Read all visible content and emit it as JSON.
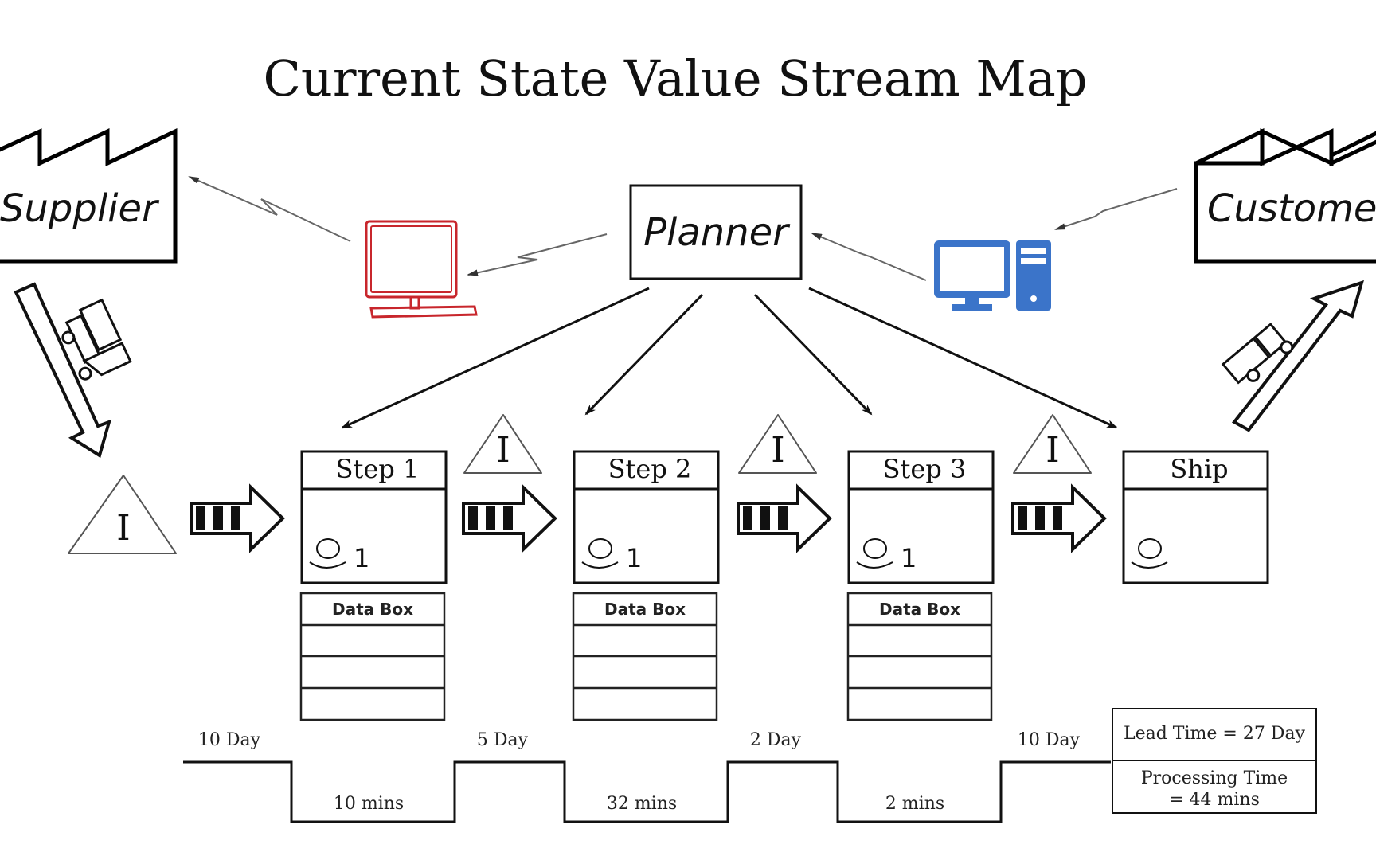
{
  "title": "Current State Value Stream Map",
  "supplier": {
    "label": "Supplier",
    "icon": "factory-icon"
  },
  "customer": {
    "label": "Customer",
    "icon": "factory-icon"
  },
  "planner": {
    "label": "Planner"
  },
  "info_systems": [
    {
      "name": "supplier-computer",
      "icon": "computer-monitor-icon",
      "color": "#c8262c"
    },
    {
      "name": "customer-computer",
      "icon": "desktop-computer-icon",
      "color": "#3b74c9"
    }
  ],
  "shipments": [
    {
      "direction": "supplier-to-process",
      "icon": "truck-icon"
    },
    {
      "direction": "process-to-customer",
      "icon": "truck-icon"
    }
  ],
  "inventory_symbol": "I",
  "processes": [
    {
      "title": "Step 1",
      "operators": "1",
      "databox": "Data Box"
    },
    {
      "title": "Step 2",
      "operators": "1",
      "databox": "Data Box"
    },
    {
      "title": "Step 3",
      "operators": "1",
      "databox": "Data Box"
    },
    {
      "title": "Ship",
      "operators": "",
      "databox": null
    }
  ],
  "timeline": {
    "wait_times": [
      "10 Day",
      "5 Day",
      "2 Day",
      "10 Day"
    ],
    "process_times": [
      "10 mins",
      "32 mins",
      "2 mins"
    ]
  },
  "summary": {
    "lead_time": "Lead Time = 27 Day",
    "processing_time_line1": "Processing Time",
    "processing_time_line2": "= 44 mins"
  }
}
